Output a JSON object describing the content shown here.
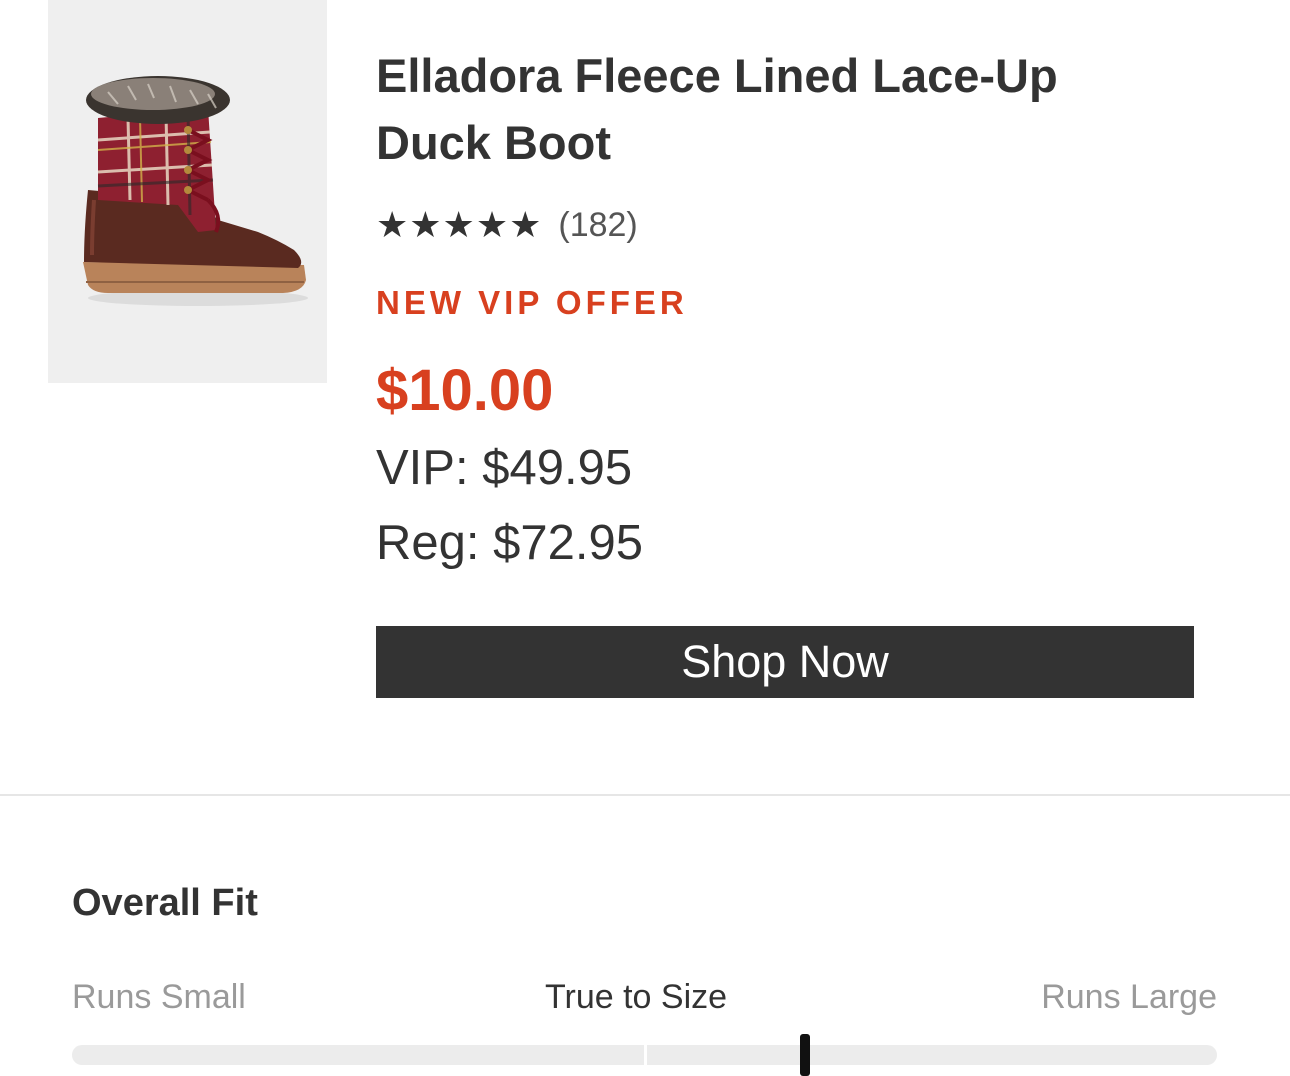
{
  "product": {
    "image_alt": "boot-product-image",
    "title": "Elladora Fleece Lined Lace-Up Duck Boot",
    "rating_stars": "★★★★★",
    "rating_value": 5,
    "review_count": "(182)",
    "offer_label": "NEW VIP OFFER",
    "sale_price": "$10.00",
    "vip_price": "VIP: $49.95",
    "reg_price": "Reg: $72.95",
    "cta_label": "Shop Now"
  },
  "fit": {
    "heading": "Overall Fit",
    "labels": {
      "small": "Runs Small",
      "true": "True to Size",
      "large": "Runs Large"
    },
    "marker_position_fraction": 0.64
  },
  "colors": {
    "accent": "#d8401f",
    "button": "#333333",
    "text": "#333333",
    "muted": "#9a9a9a"
  }
}
